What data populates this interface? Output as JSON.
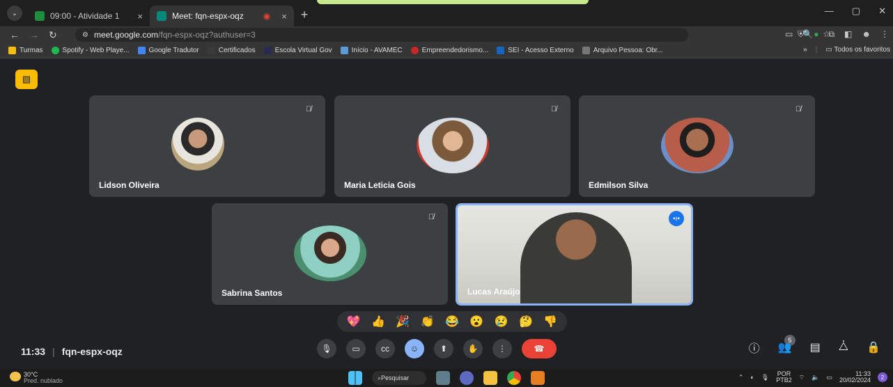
{
  "browser": {
    "tabs": [
      {
        "label": "09:00 - Atividade 1",
        "close": "×"
      },
      {
        "label": "Meet: fqn-espx-oqz",
        "close": "×"
      }
    ],
    "new_tab": "+",
    "window_controls": [
      "—",
      "▢",
      "✕"
    ],
    "url_host": "meet.google.com",
    "url_path": "/fqn-espx-oqz?authuser=3",
    "bookmarks": [
      "Turmas",
      "Spotify - Web Playe...",
      "Google Tradutor",
      "Certificados",
      "Escola Virtual Gov",
      "Início - AVAMEC",
      "Empreendedorismo...",
      "SEI - Acesso Externo",
      "Arquivo Pessoa: Obr..."
    ],
    "bookmarks_overflow": "»",
    "all_bookmarks": "Todos os favoritos"
  },
  "meet": {
    "participants": [
      {
        "name": "Lidson Oliveira"
      },
      {
        "name": "Maria Leticia Gois"
      },
      {
        "name": "Edmilson Silva"
      },
      {
        "name": "Sabrina Santos"
      },
      {
        "name": "Lucas Araújo"
      }
    ],
    "reactions": [
      "💖",
      "👍",
      "🎉",
      "👏",
      "😂",
      "😮",
      "😢",
      "🤔",
      "👎"
    ],
    "time": "11:33",
    "separator": "|",
    "meeting_code": "fqn-espx-oqz",
    "people_count": "5"
  },
  "taskbar": {
    "temperature": "30°C",
    "weather": "Pred. nublado",
    "search": "Pesquisar",
    "lang_line1": "POR",
    "lang_line2": "PTB2",
    "clock_time": "11:33",
    "clock_date": "20/02/2024",
    "notifications": "2"
  }
}
